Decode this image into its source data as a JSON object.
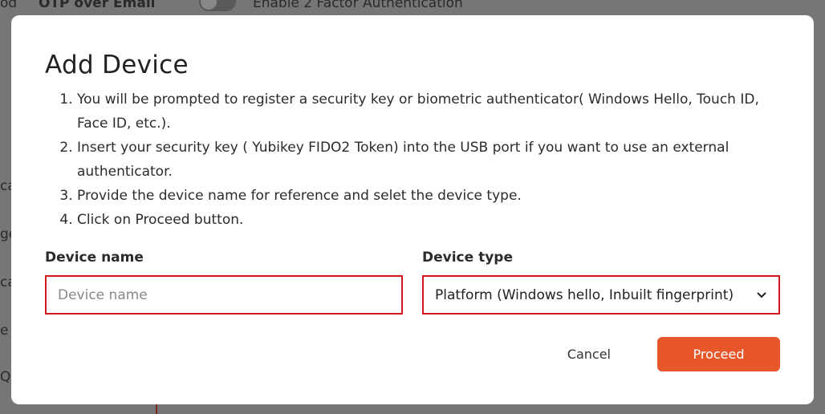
{
  "background": {
    "frag_top_left": "od",
    "otp_label": "OTP over Email",
    "toggle_label": "Enable 2 Factor Authentication",
    "side_frags": [
      "ca",
      "ge",
      "ca",
      "e T",
      "Q"
    ]
  },
  "modal": {
    "title": "Add Device",
    "instructions": [
      "You will be prompted to register a security key or biometric authenticator( Windows Hello, Touch ID, Face ID, etc.).",
      "Insert your security key ( Yubikey FIDO2 Token) into the USB port if you want to use an external authenticator.",
      "Provide the device name for reference and selet the device type.",
      "Click on Proceed button."
    ],
    "device_name": {
      "label": "Device name",
      "placeholder": "Device name",
      "value": ""
    },
    "device_type": {
      "label": "Device type",
      "selected": "Platform (Windows hello, Inbuilt fingerprint)"
    },
    "cancel_label": "Cancel",
    "proceed_label": "Proceed"
  },
  "colors": {
    "accent": "#e8572a",
    "error_border": "#d0171c",
    "overlay": "#767676"
  }
}
